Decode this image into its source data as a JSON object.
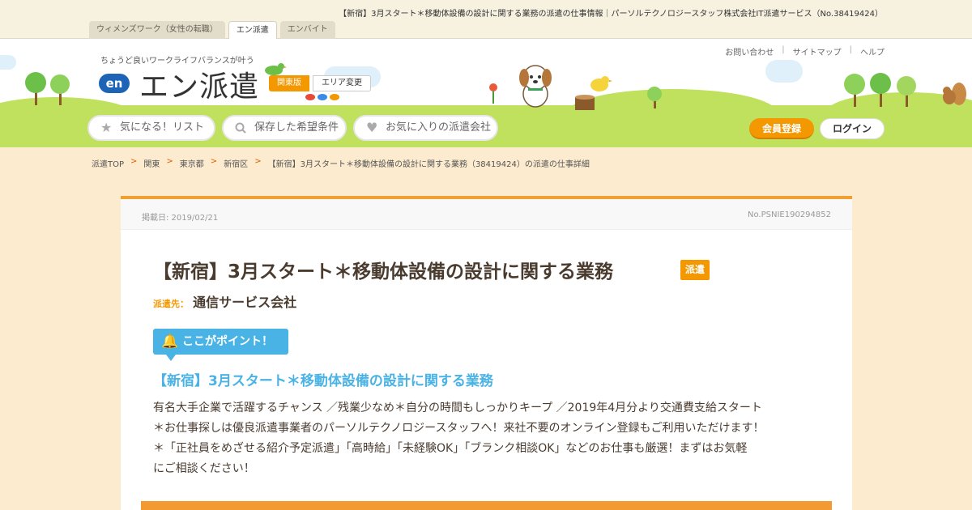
{
  "topbar": {
    "page_title": "【新宿】3月スタート＊移動体設備の設計に関する業務の派遣の仕事情報｜パーソルテクノロジースタッフ株式会社IT派遣サービス（No.38419424）",
    "tabs": [
      "ウィメンズワーク（女性の転職）",
      "エン派遣",
      "エンバイト"
    ]
  },
  "header": {
    "tagline": "ちょうど良いワークライフバランスが叶う",
    "logo_mark": "en",
    "logo_text": "エン派遣",
    "region": "関東版",
    "area_change": "エリア変更",
    "util_links": [
      "お問い合わせ",
      "サイトマップ",
      "ヘルプ"
    ],
    "util_sep": "|",
    "nav": {
      "watchlist": "気になる！リスト",
      "saved": "保存した希望条件",
      "favorites": "お気に入りの派遣会社"
    },
    "register": "会員登録",
    "login": "ログイン"
  },
  "breadcrumb": {
    "items": [
      "派遣TOP",
      "関東",
      "東京都",
      "新宿区",
      "【新宿】3月スタート＊移動体設備の設計に関する業務（38419424）の派遣の仕事詳細"
    ],
    "sep": ">"
  },
  "job": {
    "posted": "掲載日: 2019/02/21",
    "number": "No.PSNIE190294852",
    "title": "【新宿】3月スタート＊移動体設備の設計に関する業務",
    "badge": "派遣",
    "dest_label": "派遣先：",
    "dest_name": "通信サービス会社",
    "point_label": "ここがポイント！",
    "headline": "【新宿】3月スタート＊移動体設備の設計に関する業務",
    "desc_lines": [
      "有名大手企業で活躍するチャンス ／残業少なめ＊自分の時間もしっかりキープ ／2019年4月分より交通費支給スタート",
      "＊お仕事探しは優良派遣事業者のパーソルテクノロジースタッフへ！来社不要のオンライン登録もご利用いただけます！",
      "＊「正社員をめざせる紹介予定派遣」「高時給」「未経験OK」「ブランク相談OK」などのお仕事も厳選！まずはお気軽",
      "にご相談ください！"
    ]
  },
  "icons": {
    "star": "★",
    "search": "🔍",
    "heart": "♥",
    "bell": "🔔"
  },
  "colors": {
    "accent": "#f39800",
    "point_blue": "#4ab3e6",
    "grass": "#bfe15d",
    "background": "#fcebcf"
  }
}
